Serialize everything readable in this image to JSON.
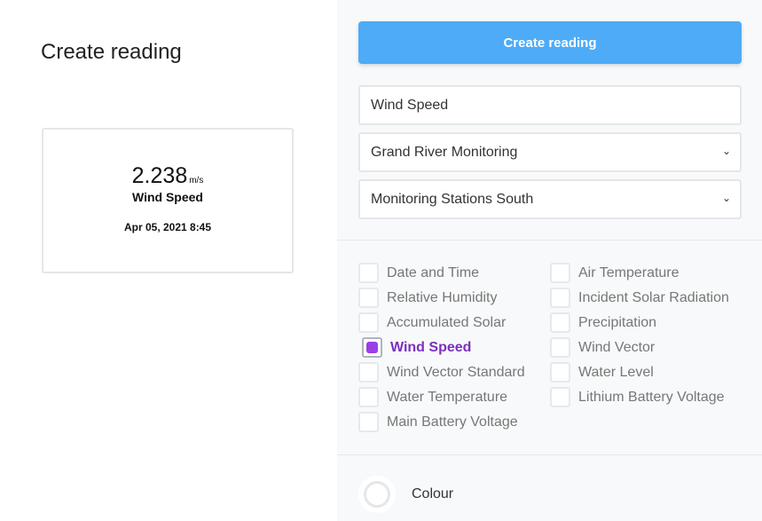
{
  "page": {
    "title": "Create reading"
  },
  "preview": {
    "value": "2.238",
    "unit": "m/s",
    "name": "Wind Speed",
    "datetime": "Apr 05, 2021 8:45"
  },
  "form": {
    "submit_label": "Create reading",
    "name_value": "Wind Speed",
    "project_value": "Grand River Monitoring",
    "group_value": "Monitoring Stations South",
    "colour_label": "Colour",
    "accent_color": "#4dabf7",
    "checked_color": "#9b3ee8"
  },
  "fields": [
    {
      "label": "Date and Time",
      "checked": false
    },
    {
      "label": "Air Temperature",
      "checked": false
    },
    {
      "label": "Relative Humidity",
      "checked": false
    },
    {
      "label": "Incident Solar Radiation",
      "checked": false
    },
    {
      "label": "Accumulated Solar",
      "checked": false
    },
    {
      "label": "Precipitation",
      "checked": false
    },
    {
      "label": "Wind Speed",
      "checked": true
    },
    {
      "label": "Wind Vector",
      "checked": false
    },
    {
      "label": "Wind Vector Standard",
      "checked": false
    },
    {
      "label": "Water Level",
      "checked": false
    },
    {
      "label": "Water Temperature",
      "checked": false
    },
    {
      "label": "Lithium Battery Voltage",
      "checked": false
    },
    {
      "label": "Main Battery Voltage",
      "checked": false
    }
  ]
}
